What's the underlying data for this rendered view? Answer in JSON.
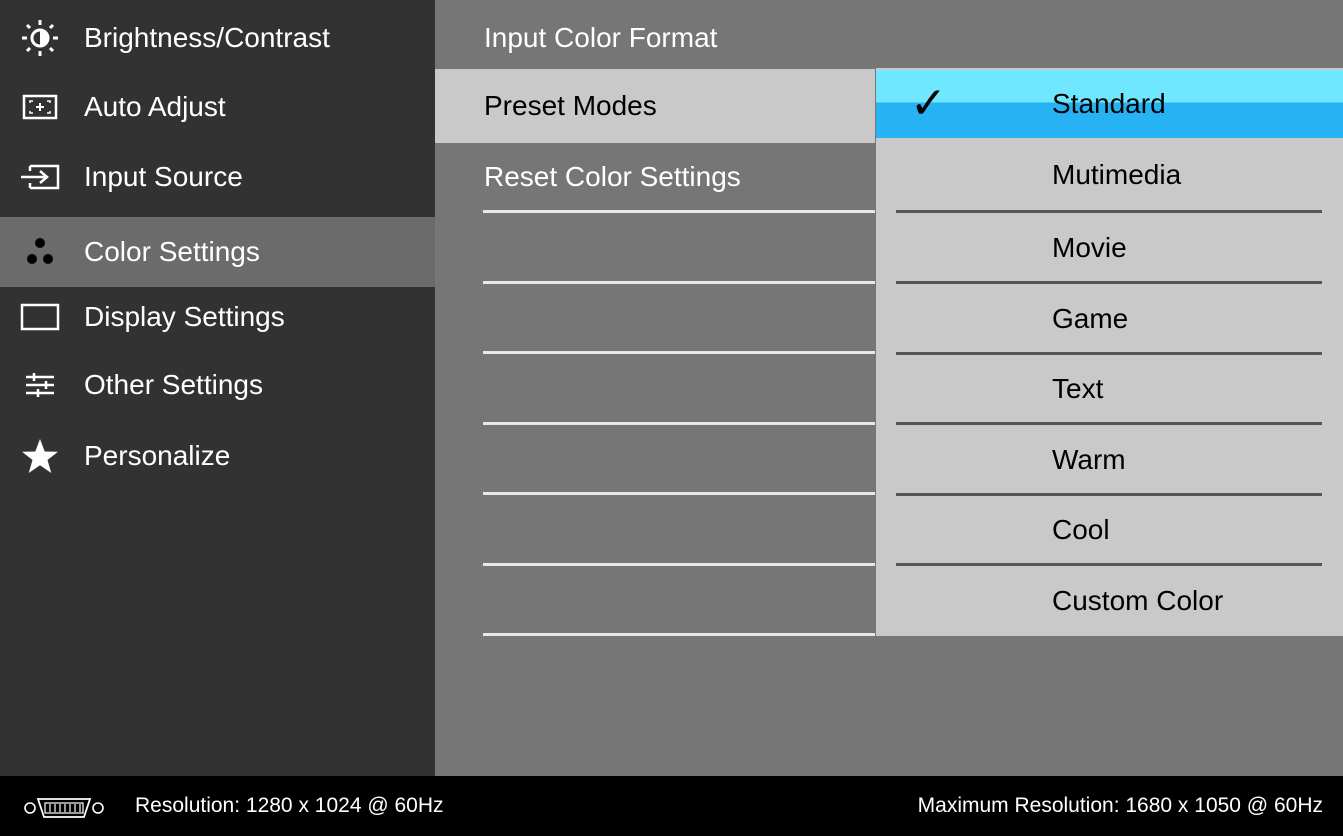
{
  "left_menu": {
    "items": [
      {
        "label": "Brightness/Contrast",
        "icon": "brightness-icon"
      },
      {
        "label": "Auto Adjust",
        "icon": "auto-adjust-icon"
      },
      {
        "label": "Input Source",
        "icon": "input-source-icon"
      },
      {
        "label": "Color Settings",
        "icon": "color-settings-icon",
        "active": true
      },
      {
        "label": "Display Settings",
        "icon": "display-settings-icon"
      },
      {
        "label": "Other Settings",
        "icon": "other-settings-icon"
      },
      {
        "label": "Personalize",
        "icon": "star-icon"
      }
    ]
  },
  "middle_menu": {
    "items": [
      {
        "label": "Input Color Format"
      },
      {
        "label": "Preset Modes",
        "active": true
      },
      {
        "label": "Reset Color Settings"
      }
    ]
  },
  "preset_submenu": {
    "selected_marker": "✓",
    "items": [
      {
        "label": "Standard",
        "selected": true
      },
      {
        "label": "Mutimedia"
      },
      {
        "label": "Movie"
      },
      {
        "label": "Game"
      },
      {
        "label": "Text"
      },
      {
        "label": "Warm"
      },
      {
        "label": "Cool"
      },
      {
        "label": "Custom Color"
      }
    ]
  },
  "footer": {
    "resolution": "Resolution: 1280 x 1024 @ 60Hz",
    "max_resolution": "Maximum Resolution: 1680 x 1050 @ 60Hz",
    "connector_icon": "vga-connector-icon"
  },
  "colors": {
    "left_bg": "#323232",
    "left_active": "#6b6b6b",
    "mid_bg": "#767676",
    "submenu_bg": "#c9c9c9",
    "selected_top": "#6fe7ff",
    "selected_bottom": "#27b2f4"
  }
}
